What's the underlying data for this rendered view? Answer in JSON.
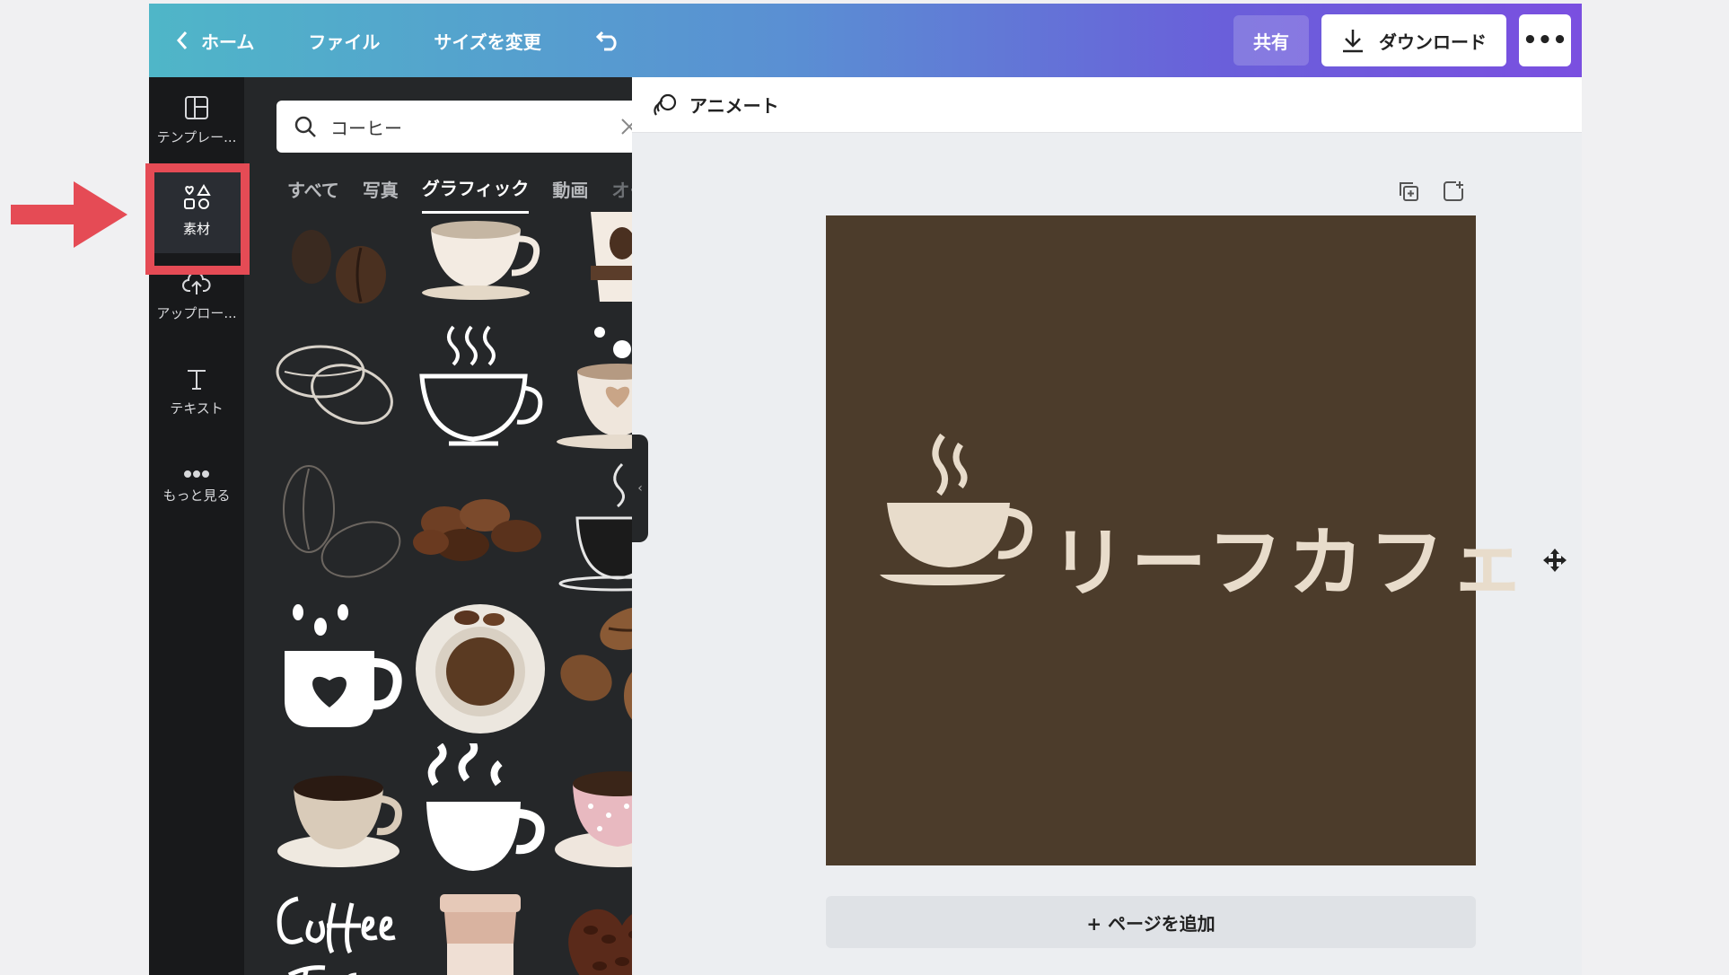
{
  "topbar": {
    "back_label": "ホーム",
    "file_label": "ファイル",
    "resize_label": "サイズを変更",
    "share_label": "共有",
    "download_label": "ダウンロード",
    "more_label": "•••"
  },
  "sidebar": {
    "items": [
      {
        "label": "テンプレー..."
      },
      {
        "label": "素材"
      },
      {
        "label": "アップロー..."
      },
      {
        "label": "テキスト"
      },
      {
        "label": "もっと見る"
      }
    ]
  },
  "panel": {
    "search_value": "コーヒー",
    "tabs": [
      "すべて",
      "写真",
      "グラフィック",
      "動画",
      "オーデ"
    ],
    "active_tab": "グラフィック"
  },
  "canvas": {
    "animate_label": "アニメート",
    "design_text": "リーフカフェ",
    "add_page_label": "+ ページを追加"
  },
  "colors": {
    "accent_highlight": "#e54b55",
    "design_bg": "#4c3c2b",
    "design_text": "#e8dccb"
  }
}
